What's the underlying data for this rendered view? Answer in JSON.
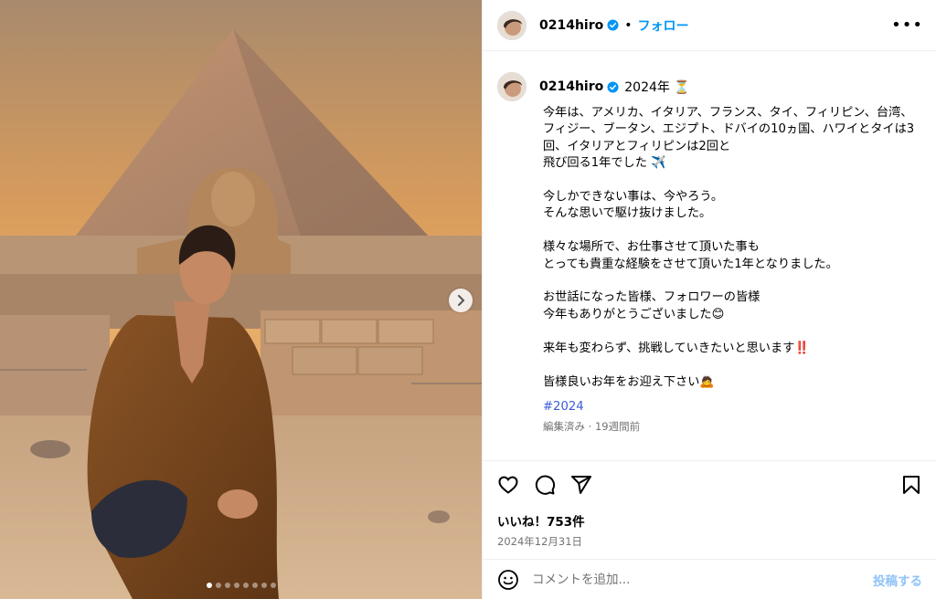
{
  "post": {
    "username": "0214hiro",
    "dot_separator": "•",
    "follow_label": "フォロー",
    "more_label": "•••",
    "carousel": {
      "slide_count": 8,
      "active_index": 0
    }
  },
  "caption": {
    "username": "0214hiro",
    "inline_text": "2024年 ⏳",
    "body": "今年は、アメリカ、イタリア、フランス、タイ、フィリピン、台湾、フィジー、ブータン、エジプト、ドバイの10ヵ国、ハワイとタイは3回、イタリアとフィリピンは2回と\n飛び回る1年でした ✈️\n\n今しかできない事は、今やろう。\nそんな思いで駆け抜けました。\n\n様々な場所で、お仕事させて頂いた事も\nとっても貴重な経験をさせて頂いた1年となりました。\n\nお世話になった皆様、フォロワーの皆様\n今年もありがとうございました😊\n\n来年も変わらず、挑戦していきたいと思います‼️\n\n皆様良いお年をお迎え下さい🙇",
    "hashtag": "#2024",
    "edited_meta": "編集済み · 19週間前"
  },
  "actions": {
    "icons": [
      "heart-icon",
      "comment-icon",
      "share-icon",
      "bookmark-icon"
    ],
    "likes": "いいね！753件",
    "date": "2024年12月31日"
  },
  "comment_box": {
    "placeholder": "コメントを追加...",
    "post_label": "投稿する"
  },
  "colors": {
    "accent": "#0095f6",
    "verified": "#0095f6",
    "hashtag": "#3b5bdb",
    "meta_gray": "#737373",
    "post_button_disabled": "#8fc3f7"
  }
}
